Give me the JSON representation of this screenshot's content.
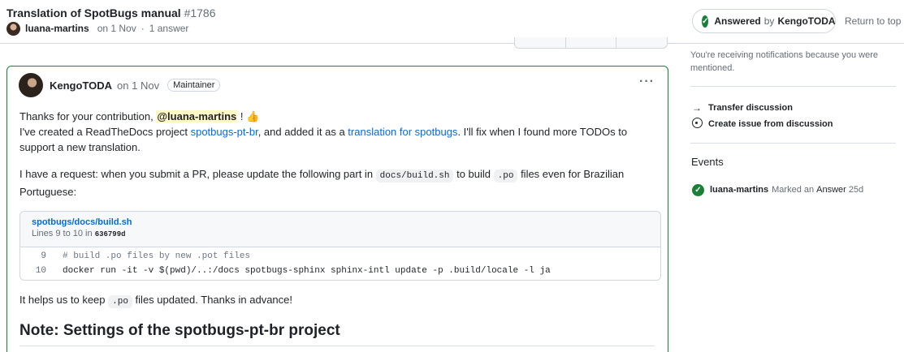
{
  "header": {
    "title": "Translation of SpotBugs manual",
    "number": "#1786",
    "author": "luana-martins",
    "date": "on 1 Nov",
    "separator": "·",
    "answers": "1 answer",
    "answered_label": "Answered",
    "answered_by": "by",
    "answered_user": "KengoTODA",
    "return_to_top": "Return to top"
  },
  "comment": {
    "author": "KengoTODA",
    "date": "on 1 Nov",
    "badge": "Maintainer",
    "menu_icon": "kebab-horizontal-icon",
    "p1_a": "Thanks for your contribution, ",
    "p1_mention": "@luana-martins",
    "p1_b": " ! 👍",
    "p1_c": "I've created a ReadTheDocs project ",
    "p1_link1": "spotbugs-pt-br",
    "p1_d": ", and added it as a ",
    "p1_link2": "translation for spotbugs",
    "p1_e": ". I'll fix when I found more TODOs to support a new translation.",
    "p2_a": "I have a request: when you submit a PR, please update the following part in ",
    "p2_code1": "docs/build.sh",
    "p2_b": " to build ",
    "p2_code2": ".po",
    "p2_c": " files even for Brazilian Portuguese:",
    "snippet": {
      "path": "spotbugs/docs/build.sh",
      "lines_label": "Lines 9 to 10 in",
      "sha": "636799d",
      "lines": [
        {
          "num": "9",
          "text": "# build .po files by new .pot files"
        },
        {
          "num": "10",
          "text": "docker run -it -v $(pwd)/..:/docs spotbugs-sphinx sphinx-intl update -p .build/locale -l ja"
        }
      ]
    },
    "p3_a": "It helps us to keep ",
    "p3_code": ".po",
    "p3_b": " files updated. Thanks in advance!",
    "heading": "Note: Settings of the spotbugs-pt-br project"
  },
  "sidebar": {
    "notification": "You're receiving notifications because you were mentioned.",
    "transfer": "Transfer discussion",
    "create_issue": "Create issue from discussion",
    "events_title": "Events",
    "event_user": "luana-martins",
    "event_text_a": "Marked an",
    "event_text_b": "Answer",
    "event_time": "25d"
  },
  "colors": {
    "accent_green": "#1a7f37",
    "link_blue": "#0969da",
    "mention_bg": "#fff8c5"
  }
}
